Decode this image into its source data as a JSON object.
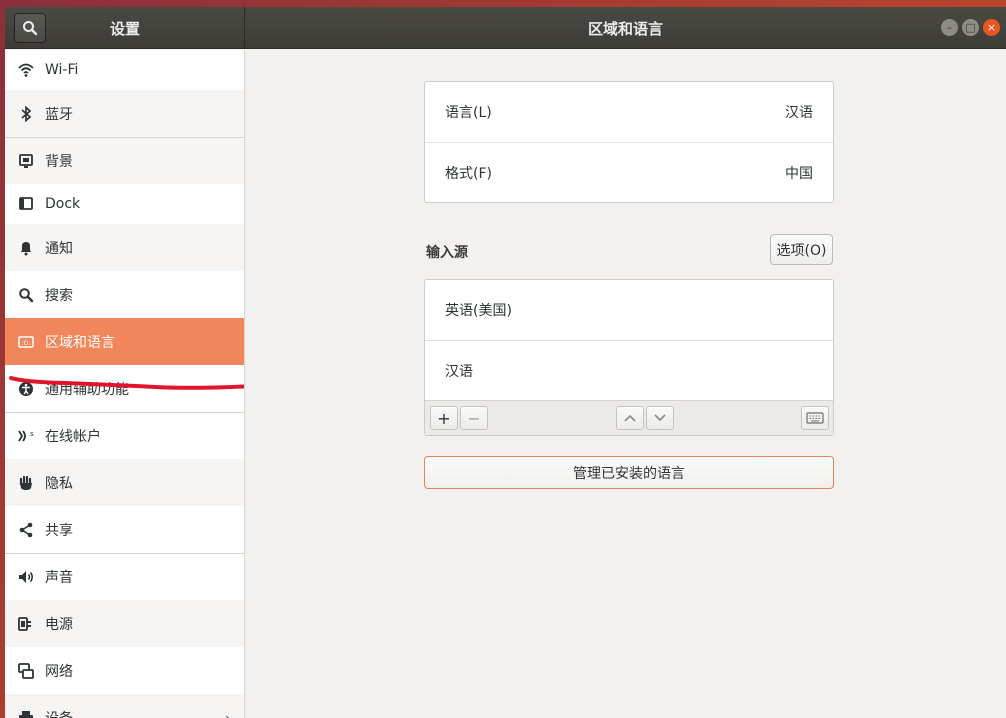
{
  "titlebar": {
    "settings_title": "设置",
    "panel_title": "区域和语言",
    "controls": [
      "minimize",
      "maximize",
      "close"
    ]
  },
  "sidebar": {
    "items": [
      {
        "label": "Wi-Fi",
        "icon": "wifi-icon"
      },
      {
        "label": "蓝牙",
        "icon": "bluetooth-icon"
      },
      {
        "label": "背景",
        "icon": "background-icon"
      },
      {
        "label": "Dock",
        "icon": "dock-icon"
      },
      {
        "label": "通知",
        "icon": "bell-icon"
      },
      {
        "label": "搜索",
        "icon": "search-icon"
      },
      {
        "label": "区域和语言",
        "icon": "region-language-icon",
        "active": true
      },
      {
        "label": "通用辅助功能",
        "icon": "accessibility-icon"
      },
      {
        "label": "在线帐户",
        "icon": "online-accounts-icon"
      },
      {
        "label": "隐私",
        "icon": "privacy-hand-icon"
      },
      {
        "label": "共享",
        "icon": "share-icon"
      },
      {
        "label": "声音",
        "icon": "speaker-icon"
      },
      {
        "label": "电源",
        "icon": "power-plug-icon"
      },
      {
        "label": "网络",
        "icon": "network-icon"
      },
      {
        "label": "设备",
        "icon": "printer-icon"
      }
    ]
  },
  "main": {
    "language_label": "语言(L)",
    "language_value": "汉语",
    "format_label": "格式(F)",
    "format_value": "中国",
    "input_sources_title": "输入源",
    "options_button": "选项(O)",
    "input_sources": [
      "英语(美国)",
      "汉语"
    ],
    "add_label": "+",
    "remove_label": "−",
    "manage_button": "管理已安装的语言"
  },
  "colors": {
    "accent": "#f0865a",
    "annotation": "#e0142a"
  }
}
